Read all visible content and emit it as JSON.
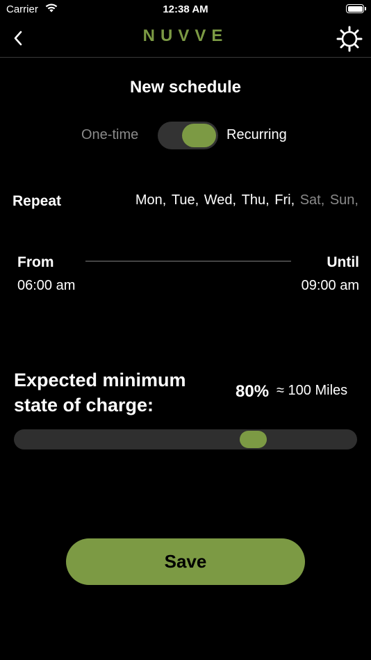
{
  "status_bar": {
    "carrier": "Carrier",
    "time": "12:38 AM"
  },
  "nav": {
    "logo": "NUVVE"
  },
  "title": "New schedule",
  "mode": {
    "one_time_label": "One-time",
    "recurring_label": "Recurring",
    "recurring_on": true
  },
  "repeat": {
    "label": "Repeat",
    "days": [
      {
        "label": "Mon,",
        "selected": true
      },
      {
        "label": "Tue,",
        "selected": true
      },
      {
        "label": "Wed,",
        "selected": true
      },
      {
        "label": "Thu,",
        "selected": true
      },
      {
        "label": "Fri,",
        "selected": true
      },
      {
        "label": "Sat,",
        "selected": false
      },
      {
        "label": "Sun,",
        "selected": false
      }
    ]
  },
  "time_range": {
    "from_label": "From",
    "from_value": "06:00 am",
    "until_label": "Until",
    "until_value": "09:00 am"
  },
  "charge": {
    "label": "Expected minimum state of charge:",
    "percent": "80%",
    "miles": "≈ 100 Miles",
    "slider_value": 0.8
  },
  "save_label": "Save",
  "colors": {
    "accent": "#7c9a44",
    "background": "#000000",
    "muted": "#8a8a8a"
  },
  "icons": {
    "back": "chevron-left-icon",
    "settings": "gear-icon",
    "wifi": "wifi-icon",
    "battery": "battery-icon"
  }
}
